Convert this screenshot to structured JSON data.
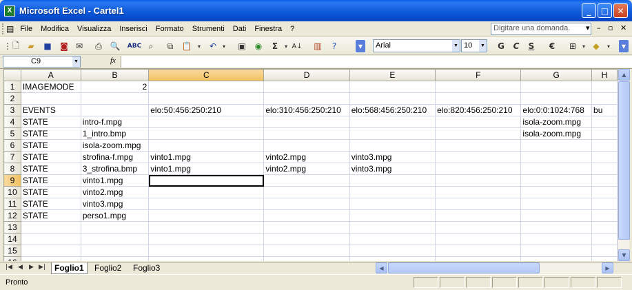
{
  "window": {
    "title": "Microsoft Excel - Cartel1",
    "app_icon": "X"
  },
  "menubar": {
    "items": [
      "File",
      "Modifica",
      "Visualizza",
      "Inserisci",
      "Formato",
      "Strumenti",
      "Dati",
      "Finestra",
      "?"
    ],
    "help_placeholder": "Digitare una domanda."
  },
  "toolbar": {
    "font": "Arial",
    "size": "10",
    "bold": "G",
    "italic": "C",
    "underline": "S",
    "euro": "€"
  },
  "formula": {
    "name_box": "C9",
    "fx": "fx",
    "content": ""
  },
  "grid": {
    "columns": [
      "A",
      "B",
      "C",
      "D",
      "E",
      "F",
      "G",
      "H"
    ],
    "rows": [
      {
        "n": "1",
        "cells": [
          "IMAGEMODE",
          "2",
          "",
          "",
          "",
          "",
          "",
          ""
        ]
      },
      {
        "n": "2",
        "cells": [
          "",
          "",
          "",
          "",
          "",
          "",
          "",
          ""
        ]
      },
      {
        "n": "3",
        "cells": [
          "EVENTS",
          "",
          "elo:50:456:250:210",
          "elo:310:456:250:210",
          "elo:568:456:250:210",
          "elo:820:456:250:210",
          "elo:0:0:1024:768",
          "bu"
        ]
      },
      {
        "n": "4",
        "cells": [
          "STATE",
          "intro-f.mpg",
          "",
          "",
          "",
          "",
          "isola-zoom.mpg",
          ""
        ]
      },
      {
        "n": "5",
        "cells": [
          "STATE",
          "1_intro.bmp",
          "",
          "",
          "",
          "",
          "isola-zoom.mpg",
          ""
        ]
      },
      {
        "n": "6",
        "cells": [
          "STATE",
          "isola-zoom.mpg",
          "",
          "",
          "",
          "",
          "",
          ""
        ]
      },
      {
        "n": "7",
        "cells": [
          "STATE",
          "strofina-f.mpg",
          "vinto1.mpg",
          "vinto2.mpg",
          "vinto3.mpg",
          "",
          "",
          ""
        ]
      },
      {
        "n": "8",
        "cells": [
          "STATE",
          "3_strofina.bmp",
          "vinto1.mpg",
          "vinto2.mpg",
          "vinto3.mpg",
          "",
          "",
          ""
        ]
      },
      {
        "n": "9",
        "cells": [
          "STATE",
          "vinto1.mpg",
          "",
          "",
          "",
          "",
          "",
          ""
        ]
      },
      {
        "n": "10",
        "cells": [
          "STATE",
          "vinto2.mpg",
          "",
          "",
          "",
          "",
          "",
          ""
        ]
      },
      {
        "n": "11",
        "cells": [
          "STATE",
          "vinto3.mpg",
          "",
          "",
          "",
          "",
          "",
          ""
        ]
      },
      {
        "n": "12",
        "cells": [
          "STATE",
          "perso1.mpg",
          "",
          "",
          "",
          "",
          "",
          ""
        ]
      },
      {
        "n": "13",
        "cells": [
          "",
          "",
          "",
          "",
          "",
          "",
          "",
          ""
        ]
      },
      {
        "n": "14",
        "cells": [
          "",
          "",
          "",
          "",
          "",
          "",
          "",
          ""
        ]
      },
      {
        "n": "15",
        "cells": [
          "",
          "",
          "",
          "",
          "",
          "",
          "",
          ""
        ]
      },
      {
        "n": "16",
        "cells": [
          "",
          "",
          "",
          "",
          "",
          "",
          "",
          ""
        ]
      }
    ],
    "selected_column": "C",
    "selected_row": "9"
  },
  "sheets": {
    "tabs": [
      "Foglio1",
      "Foglio2",
      "Foglio3"
    ],
    "active": "Foglio1"
  },
  "status": {
    "text": "Pronto"
  }
}
